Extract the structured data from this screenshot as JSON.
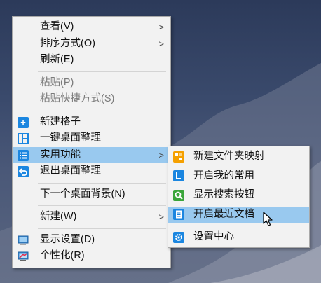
{
  "main_menu": {
    "view": "查看(V)",
    "sort": "排序方式(O)",
    "refresh": "刷新(E)",
    "paste": "粘贴(P)",
    "paste_shortcut": "粘贴快捷方式(S)",
    "new_grid": "新建格子",
    "tidy_desktop": "一键桌面整理",
    "utilities": "实用功能",
    "exit_tidy": "退出桌面整理",
    "next_background": "下一个桌面背景(N)",
    "new": "新建(W)",
    "display_settings": "显示设置(D)",
    "personalize": "个性化(R)"
  },
  "submenu": {
    "new_folder_mapping": "新建文件夹映射",
    "open_frequent": "开启我的常用",
    "show_search_button": "显示搜索按钮",
    "open_recent_docs": "开启最近文档",
    "settings_center": "设置中心"
  },
  "submenu_arrow_glyph": ">",
  "colors": {
    "menu_bg": "#f2f2f2",
    "highlight": "#99c9ef",
    "icon_blue": "#1b86e0",
    "icon_orange": "#f5a000",
    "icon_green": "#3aa53a",
    "disabled_text": "#7a7a7a"
  }
}
